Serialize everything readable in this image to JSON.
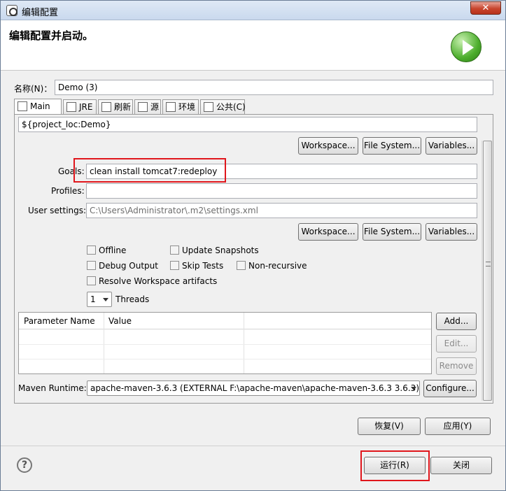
{
  "window": {
    "title": "编辑配置",
    "close_label": "✕"
  },
  "banner": {
    "text": "编辑配置并启动。",
    "run_icon": "run-play-icon"
  },
  "name": {
    "label": "名称(N)：",
    "value": "Demo (3)"
  },
  "tabs": [
    {
      "label": "Main",
      "icon": "main-icon",
      "active": true
    },
    {
      "label": "JRE",
      "icon": "jre-icon"
    },
    {
      "label": "刷新",
      "icon": "refresh-icon"
    },
    {
      "label": "源",
      "icon": "source-icon"
    },
    {
      "label": "环境",
      "icon": "environment-icon"
    },
    {
      "label": "公共(C)",
      "icon": "common-icon"
    }
  ],
  "main": {
    "base_directory": "${project_loc:Demo}",
    "buttons1": {
      "workspace": "Workspace...",
      "filesystem": "File System...",
      "variables": "Variables..."
    },
    "goals": {
      "label": "Goals:",
      "value": "clean install tomcat7:redeploy"
    },
    "profiles": {
      "label": "Profiles:",
      "value": ""
    },
    "user_settings": {
      "label": "User settings:",
      "value": "C:\\Users\\Administrator\\.m2\\settings.xml"
    },
    "buttons2": {
      "workspace": "Workspace...",
      "filesystem": "File System...",
      "variables": "Variables..."
    },
    "checks": {
      "offline": "Offline",
      "update_snapshots": "Update Snapshots",
      "debug_output": "Debug Output",
      "skip_tests": "Skip Tests",
      "non_recursive": "Non-recursive",
      "resolve_workspace": "Resolve Workspace artifacts"
    },
    "threads": {
      "value": "1",
      "label": "Threads"
    },
    "params_table": {
      "columns": [
        "Parameter Name",
        "Value"
      ],
      "rows": []
    },
    "param_buttons": {
      "add": "Add...",
      "edit": "Edit...",
      "remove": "Remove"
    },
    "maven_runtime": {
      "label": "Maven Runtime:",
      "value": "apache-maven-3.6.3 (EXTERNAL F:\\apache-maven\\apache-maven-3.6.3 3.6.3)",
      "configure": "Configure..."
    }
  },
  "footer": {
    "revert": "恢复(V)",
    "apply": "应用(Y)",
    "run": "运行(R)",
    "close": "关闭",
    "help_label": "?"
  },
  "colors": {
    "highlight": "#e0161c"
  }
}
